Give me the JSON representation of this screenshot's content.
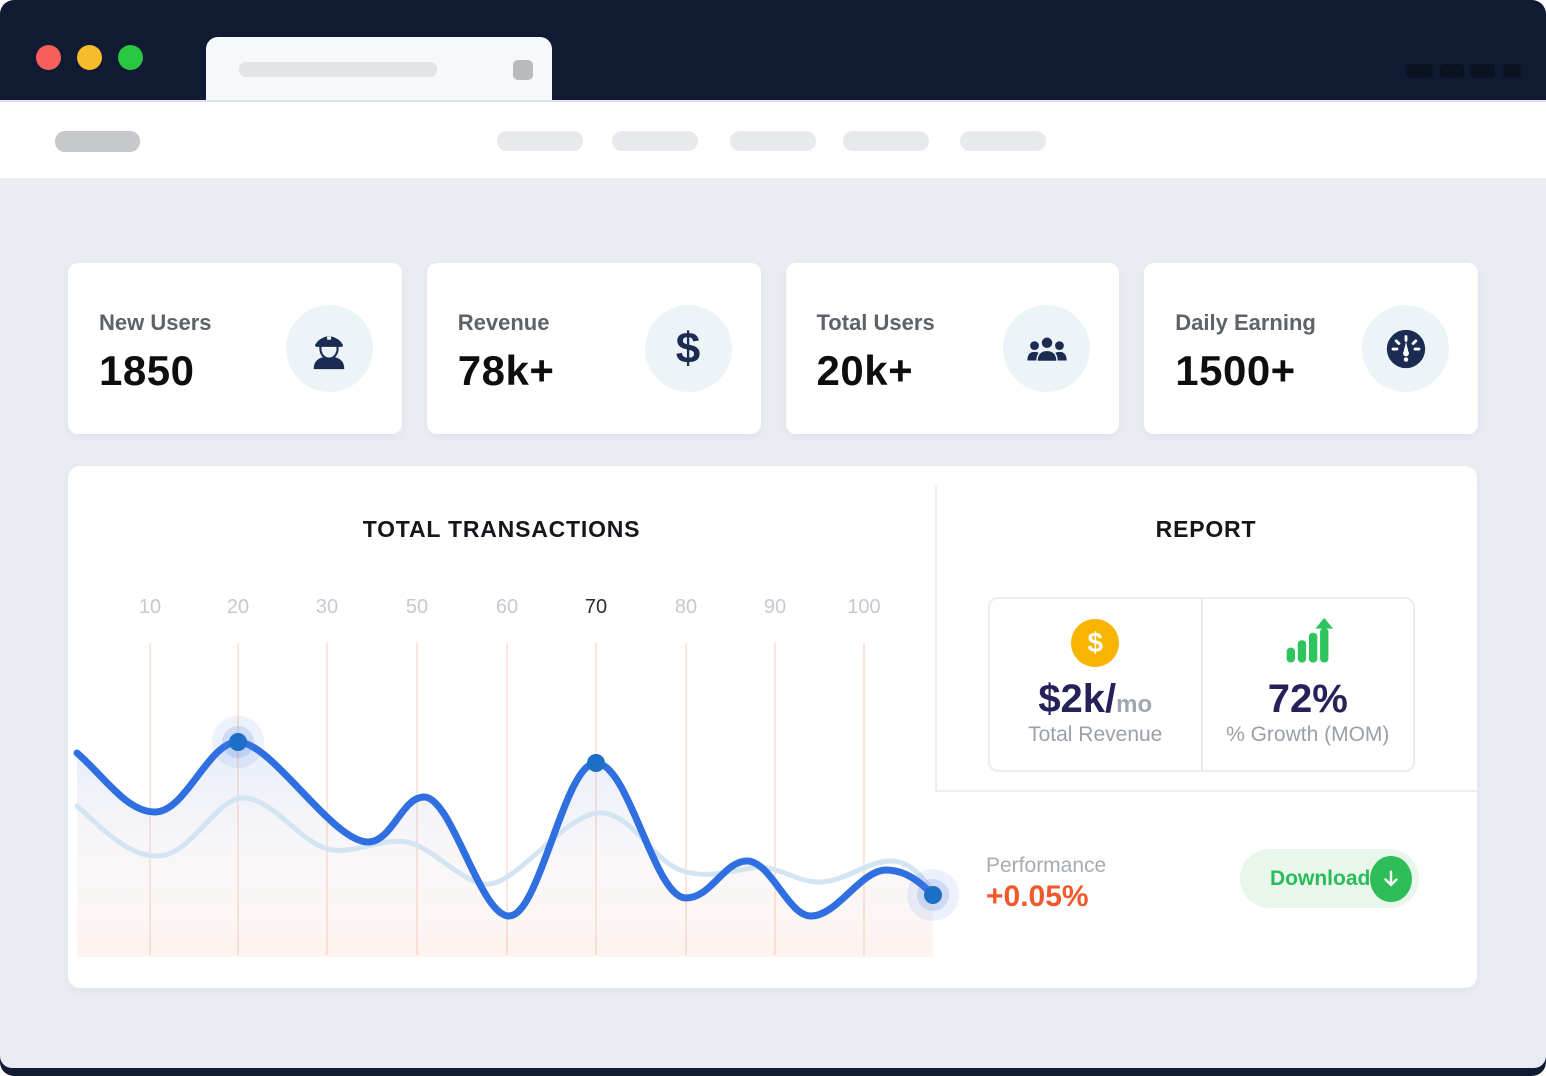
{
  "window": {
    "type": "browser-mockup",
    "colors": {
      "frame_navy": "#101b33",
      "traffic_red": "#f9605a",
      "traffic_yellow": "#f8bc2c",
      "traffic_green": "#27c83f",
      "content_bg": "#e9edf2",
      "accent_blue_line": "#2f6fe0",
      "accent_blue_dot": "#1d6ec6",
      "accent_green": "#2ebd59",
      "accent_yellow_coin": "#f7b500",
      "accent_orange": "#f2582b",
      "navy_text": "#25225a"
    }
  },
  "stats": [
    {
      "label": "New Users",
      "value": "1850",
      "icon": "officer-icon"
    },
    {
      "label": "Revenue",
      "value": "78k+",
      "icon": "dollar-icon",
      "glyph": "$"
    },
    {
      "label": "Total Users",
      "value": "20k+",
      "icon": "users-icon"
    },
    {
      "label": "Daily Earning",
      "value": "1500+",
      "icon": "gauge-icon"
    }
  ],
  "chart": {
    "title": "TOTAL TRANSACTIONS",
    "x_labels": [
      "10",
      "20",
      "30",
      "50",
      "60",
      "70",
      "80",
      "90",
      "100"
    ],
    "highlighted_label": "70"
  },
  "chart_data": {
    "type": "line",
    "title": "TOTAL TRANSACTIONS",
    "x": [
      10,
      20,
      30,
      50,
      60,
      70,
      80,
      90,
      100
    ],
    "series": [
      {
        "name": "primary-transactions",
        "color": "#2f6fe0",
        "values": [
          46,
          68,
          45,
          50,
          13,
          61,
          19,
          18,
          24
        ]
      },
      {
        "name": "secondary-trend",
        "color": "#d3e4f2",
        "values": [
          34,
          50,
          34,
          36,
          23,
          45,
          27,
          24,
          29
        ]
      }
    ],
    "ylim": [
      0,
      100
    ],
    "grid": "vertical-gridlines-only",
    "legend": "none",
    "highlighted_x_tick": 70,
    "marked_points_x": [
      20,
      70,
      100
    ],
    "area_fill": true
  },
  "report": {
    "title": "REPORT",
    "revenue": {
      "icon_glyph": "$",
      "value": "$2k/",
      "unit": "mo",
      "label": "Total Revenue"
    },
    "growth": {
      "value": "72%",
      "label": "% Growth (MOM)"
    },
    "performance": {
      "label": "Performance",
      "value": "+0.05%"
    },
    "download_label": "Download"
  }
}
